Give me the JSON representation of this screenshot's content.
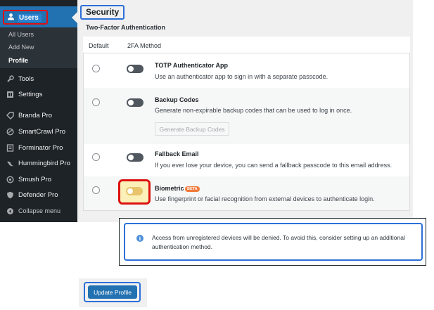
{
  "sidebar": {
    "users_label": "Users",
    "submenu": [
      "All Users",
      "Add New",
      "Profile"
    ],
    "items": [
      {
        "label": "Tools",
        "icon": "wrench-icon"
      },
      {
        "label": "Settings",
        "icon": "settings-icon"
      },
      {
        "label": "Branda Pro",
        "icon": "branda-icon"
      },
      {
        "label": "SmartCrawl Pro",
        "icon": "smartcrawl-icon"
      },
      {
        "label": "Forminator Pro",
        "icon": "forminator-icon"
      },
      {
        "label": "Hummingbird Pro",
        "icon": "hummingbird-icon"
      },
      {
        "label": "Smush Pro",
        "icon": "smush-icon"
      },
      {
        "label": "Defender Pro",
        "icon": "defender-icon"
      }
    ],
    "collapse_label": "Collapse menu"
  },
  "security": {
    "title": "Security",
    "subtitle": "Two-Factor Authentication",
    "columns": [
      "Default",
      "2FA Method"
    ],
    "methods": [
      {
        "name": "TOTP Authenticator App",
        "description": "Use an authenticator app to sign in with a separate passcode."
      },
      {
        "name": "Backup Codes",
        "description": "Generate non-expirable backup codes that can be used to log in once.",
        "button": "Generate Backup Codes"
      },
      {
        "name": "Fallback Email",
        "description": "If you ever lose your device, you can send a fallback passcode to this email address."
      },
      {
        "name": "Biometric",
        "badge": "BETA",
        "description": "Use fingerprint or facial recognition from external devices to authenticate login."
      }
    ]
  },
  "notice": {
    "icon": "info-icon",
    "text": "Access from unregistered devices will be denied. To avoid this, consider setting up an additional authentication method."
  },
  "update_button": "Update Profile",
  "colors": {
    "accent": "#2271b1",
    "sidebar": "#1d2327",
    "highlight_red": "#e01010",
    "highlight_blue": "#2c6fd8"
  }
}
